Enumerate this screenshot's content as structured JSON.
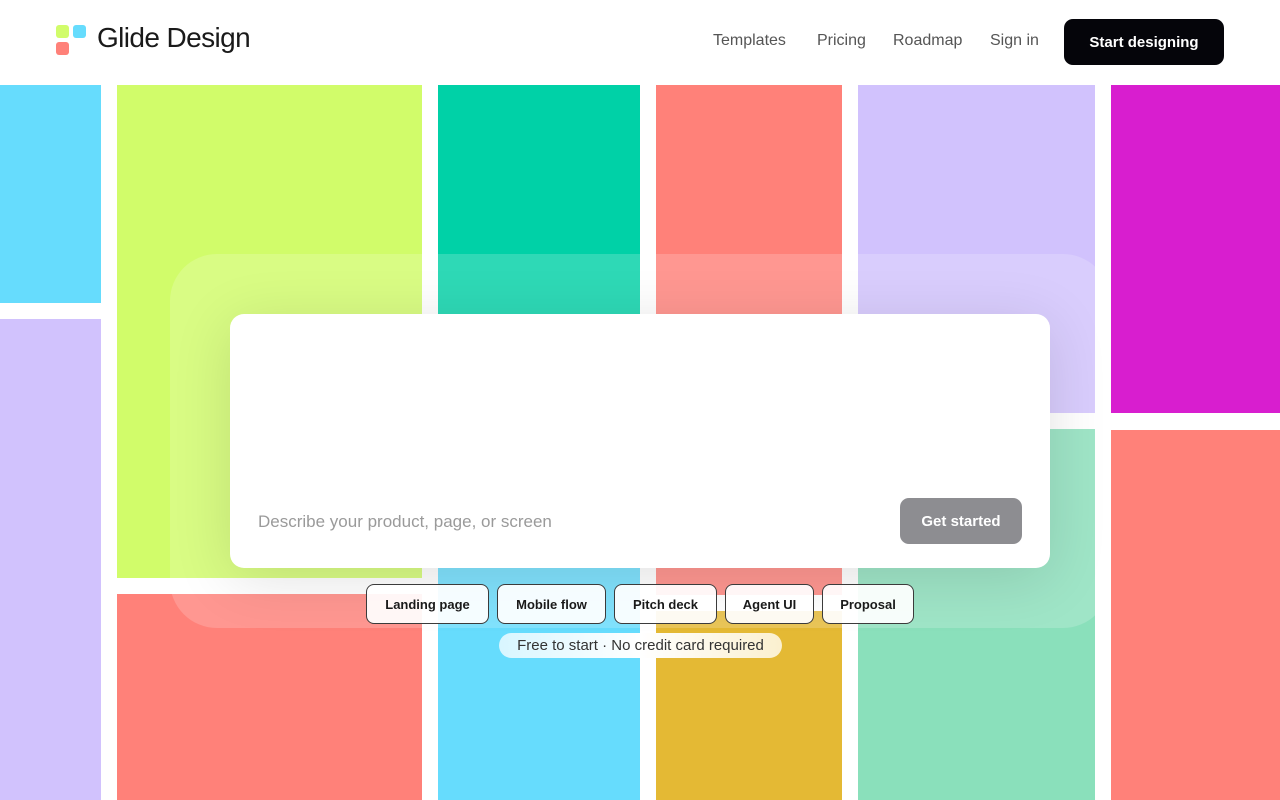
{
  "brand": {
    "name": "Glide Design",
    "logo_icon": "logo-squares-icon"
  },
  "nav": {
    "items": [
      "Templates",
      "Pricing",
      "Roadmap",
      "Sign in"
    ],
    "cta_label": "Start designing"
  },
  "prompt": {
    "placeholder": "Describe your product, page, or screen",
    "value": "",
    "submit_label": "Get started"
  },
  "chips": [
    "Landing page",
    "Mobile flow",
    "Pitch deck",
    "Agent UI",
    "Proposal"
  ],
  "note": "Free to start · No credit card required",
  "colors": {
    "lime": "#d1fc6a",
    "teal": "#00d1a7",
    "coral": "#ff8179",
    "lavender": "#d1c2fd",
    "magenta": "#d81ecf",
    "sky": "#66dcfd",
    "mint": "#8ae0bb",
    "mustard": "#e4b934",
    "cta": "#05050a",
    "button_disabled": "#8d8d91"
  }
}
